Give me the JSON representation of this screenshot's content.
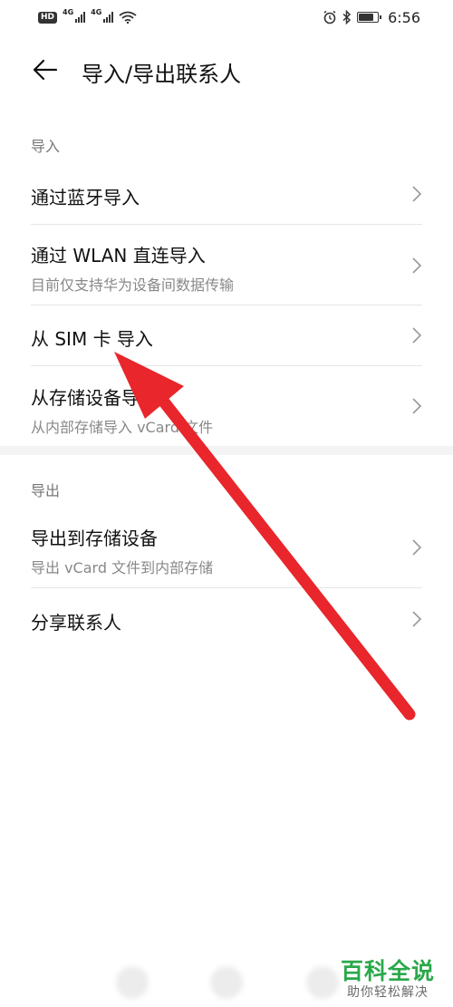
{
  "status_bar": {
    "hd": "HD",
    "net1": "4G",
    "net2": "4G",
    "time": "6:56",
    "battery_level": 0.8,
    "icons": [
      "signal-icon",
      "wifi-icon",
      "alarm-icon",
      "bluetooth-icon",
      "battery-icon"
    ]
  },
  "header": {
    "back_icon": "back-arrow-icon",
    "title": "导入/导出联系人"
  },
  "import_section": {
    "label": "导入",
    "items": [
      {
        "title": "通过蓝牙导入",
        "subtitle": ""
      },
      {
        "title": "通过 WLAN 直连导入",
        "subtitle": "目前仅支持华为设备间数据传输"
      },
      {
        "title": "从 SIM 卡 导入",
        "subtitle": ""
      },
      {
        "title": "从存储设备导入",
        "subtitle": "从内部存储导入 vCard 文件"
      }
    ]
  },
  "export_section": {
    "label": "导出",
    "items": [
      {
        "title": "导出到存储设备",
        "subtitle": "导出 vCard 文件到内部存储"
      },
      {
        "title": "分享联系人",
        "subtitle": ""
      }
    ]
  },
  "watermark": {
    "title": "百科全说",
    "subtitle": "助你轻松解决"
  },
  "colors": {
    "annotation_arrow": "#e8262b",
    "watermark": "#2aa84a",
    "text_primary": "#111111",
    "text_secondary": "#888888"
  }
}
